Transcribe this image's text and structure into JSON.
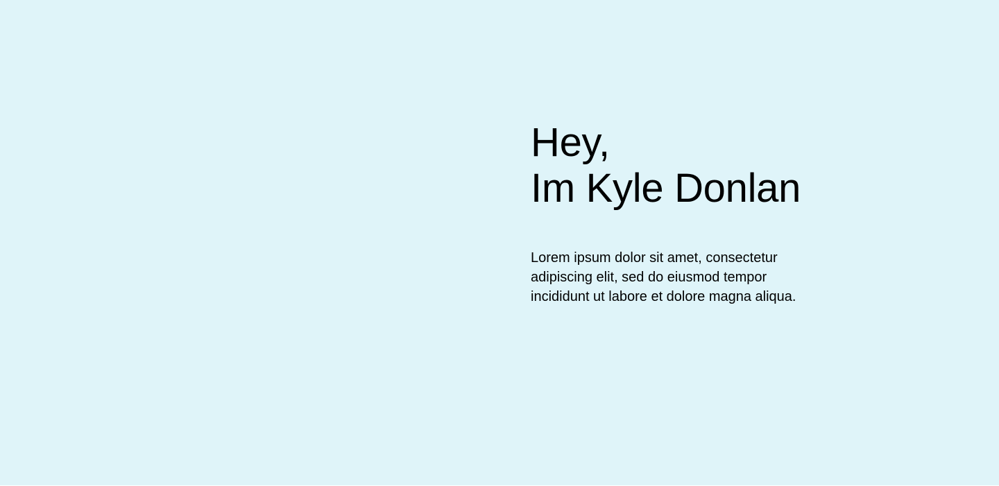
{
  "hero": {
    "heading_line1": "Hey,",
    "heading_line2": "Im Kyle Donlan",
    "body": "Lorem ipsum dolor sit amet, consectetur adipiscing elit, sed do eiusmod tempor incididunt ut labore et dolore magna aliqua.",
    "background_color": "#dff4f9"
  }
}
